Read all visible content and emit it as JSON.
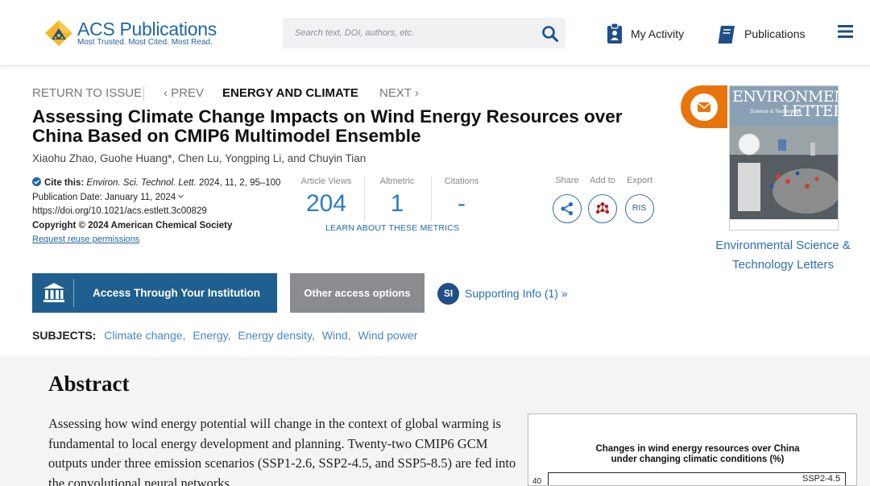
{
  "header": {
    "logo_title": "ACS Publications",
    "logo_tagline": "Most Trusted. Most Cited. Most Read.",
    "search_placeholder": "Search text, DOI, authors, etc.",
    "my_activity": "My Activity",
    "publications": "Publications"
  },
  "breadcrumb": {
    "return": "RETURN TO ISSUE",
    "prev": "‹ PREV",
    "section": "ENERGY AND CLIMATE",
    "next": "NEXT ›"
  },
  "article": {
    "title": "Assessing Climate Change Impacts on Wind Energy Resources over China Based on CMIP6 Multimodel Ensemble",
    "authors": "Xiaohu Zhao, Guohe Huang*, Chen Lu, Yongping Li, and Chuyin Tian"
  },
  "citation": {
    "label": "Cite this:",
    "journal": "Environ. Sci. Technol. Lett.",
    "ref": "2024, 11, 2, 95–100",
    "pub_date": "Publication Date: January 11, 2024",
    "doi": "https://doi.org/10.1021/acs.estlett.3c00829",
    "copyright": "Copyright © 2024 American Chemical Society",
    "reuse": "Request reuse permissions"
  },
  "metrics": {
    "views_label": "Article Views",
    "views_value": "204",
    "altmetric_label": "Altmetric",
    "altmetric_value": "1",
    "citations_label": "Citations",
    "citations_value": "-",
    "learn_more": "LEARN ABOUT THESE METRICS"
  },
  "tools": {
    "share": "Share",
    "add_to": "Add to",
    "export": "Export",
    "ris": "RIS"
  },
  "access": {
    "institution": "Access Through Your Institution",
    "other": "Other access options",
    "si_badge": "SI",
    "supporting_info": "Supporting Info (1) »"
  },
  "subjects": {
    "label": "SUBJECTS:",
    "items": [
      "Climate change",
      "Energy",
      "Energy density",
      "Wind",
      "Wind power"
    ]
  },
  "journal": {
    "cover_title_line1": "ENVIRONMENTAL",
    "cover_title_line2": "LETTERS",
    "cover_sub": "Science & Technology",
    "name": "Environmental Science & Technology Letters"
  },
  "abstract": {
    "heading": "Abstract",
    "text": "Assessing how wind energy potential will change in the context of global warming is fundamental to local energy development and planning. Twenty-two CMIP6 GCM outputs under three emission scenarios (SSP1-2.6, SSP2-4.5, and SSP5-8.5) are fed into the convolutional neural networks",
    "figure_title_line1": "Changes in wind energy resources over China",
    "figure_title_line2": "under changing climatic conditions (%)",
    "figure_y_tick": "40",
    "figure_legend": "SSP2-4.5"
  },
  "colors": {
    "brand_blue": "#1f66a8",
    "button_blue": "#1f5f8f",
    "button_gray": "#8a8d90",
    "accent_orange": "#e8740c"
  }
}
